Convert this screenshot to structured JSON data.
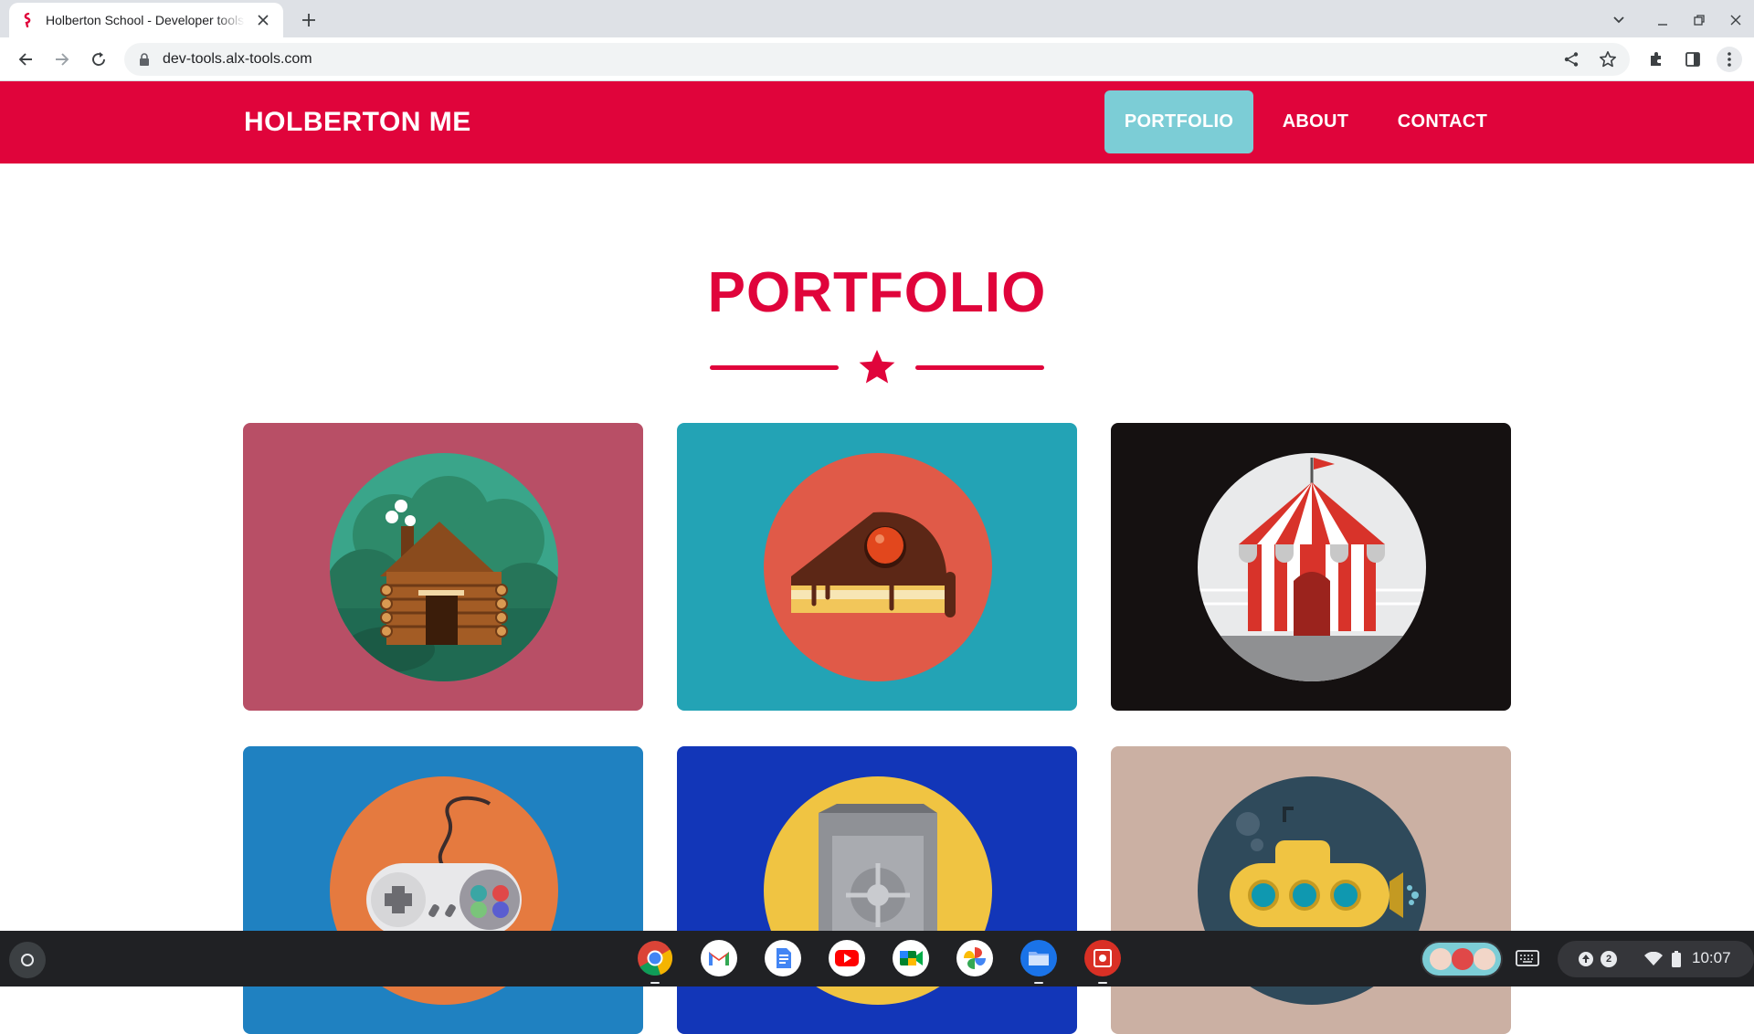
{
  "browser": {
    "tab_title": "Holberton School - Developer tools",
    "url": "dev-tools.alx-tools.com"
  },
  "site": {
    "brand": "HOLBERTON ME",
    "nav": [
      {
        "label": "PORTFOLIO",
        "active": true
      },
      {
        "label": "ABOUT",
        "active": false
      },
      {
        "label": "CONTACT",
        "active": false
      }
    ]
  },
  "portfolio": {
    "title": "PORTFOLIO",
    "cards": [
      {
        "name": "cabin",
        "background": "#b84f66",
        "circle": "#2e8a6a"
      },
      {
        "name": "cake",
        "background": "#23a3b5",
        "circle": "#e05a48"
      },
      {
        "name": "circus",
        "background": "#151111",
        "circle": "#e9eaeb"
      },
      {
        "name": "game-controller",
        "background": "#1f81c1",
        "circle": "#e57a3f"
      },
      {
        "name": "safe",
        "background": "#1236b8",
        "circle": "#f0c442"
      },
      {
        "name": "submarine",
        "background": "#cbb0a3",
        "circle": "#2f4a5b"
      }
    ]
  },
  "colors": {
    "brand_red": "#e0043b",
    "active_nav": "#7ccdd6"
  },
  "shelf": {
    "apps": [
      "chrome",
      "gmail",
      "docs",
      "youtube",
      "meet",
      "photos",
      "files",
      "screencast"
    ],
    "notification_count": "2",
    "time": "10:07"
  }
}
